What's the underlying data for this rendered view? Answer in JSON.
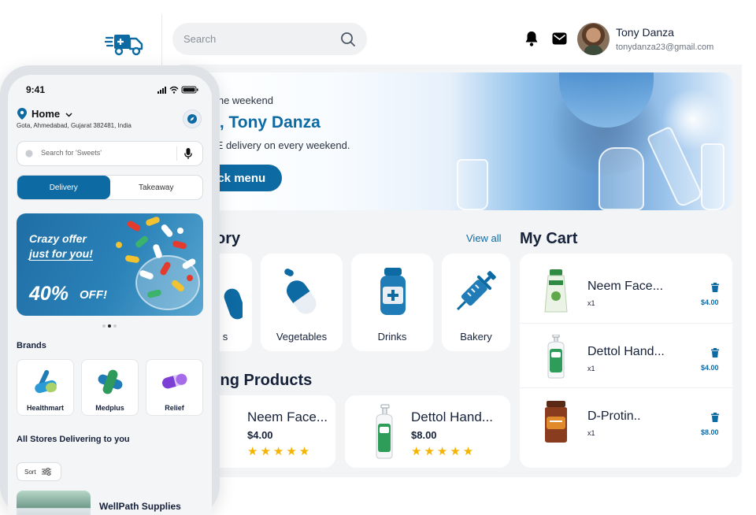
{
  "header": {
    "search_placeholder": "Search",
    "user_name": "Tony Danza",
    "user_email": "tonydanza23@gmail.com"
  },
  "hero": {
    "subtitle": "f the weekend",
    "title": "o, Tony Danza",
    "description": "EE delivery on every weekend.",
    "button_label": "eck menu"
  },
  "category": {
    "title": "ory",
    "view_all": "View all",
    "items": [
      {
        "label": "s",
        "icon": "pill-icon"
      },
      {
        "label": "Vegetables",
        "icon": "capsule-icon"
      },
      {
        "label": "Drinks",
        "icon": "medicine-bottle-icon"
      },
      {
        "label": "Bakery",
        "icon": "syringe-icon"
      }
    ]
  },
  "products": {
    "title": "ing Products",
    "items": [
      {
        "name": "Neem Face...",
        "price": "$4.00",
        "rating": "★★★★★"
      },
      {
        "name": "Dettol Hand...",
        "price": "$8.00",
        "rating": "★★★★★"
      }
    ]
  },
  "cart": {
    "title": "My Cart",
    "items": [
      {
        "name": "Neem Face...",
        "qty": "x1",
        "price": "$4.00"
      },
      {
        "name": "Dettol Hand...",
        "qty": "x1",
        "price": "$4.00"
      },
      {
        "name": "D-Protin..",
        "qty": "x1",
        "price": "$8.00"
      }
    ]
  },
  "phone": {
    "time": "9:41",
    "location_label": "Home",
    "address": "Gota, Ahmedabad, Gujarat 382481, India",
    "search_placeholder": "Search for 'Sweets'",
    "tabs": [
      "Delivery",
      "Takeaway"
    ],
    "banner": {
      "line1": "Crazy offer",
      "line2": "just for you!",
      "discount": "40%",
      "discount_suffix": "OFF!"
    },
    "brands_title": "Brands",
    "brands": [
      "Healthmart",
      "Medplus",
      "Relief"
    ],
    "stores_title": "All Stores Delivering to you",
    "sort_label": "Sort",
    "store_name": "WellPath Supplies"
  },
  "colors": {
    "accent": "#0e6aa3",
    "star": "#f5b400",
    "panel": "#f3f4f6"
  }
}
